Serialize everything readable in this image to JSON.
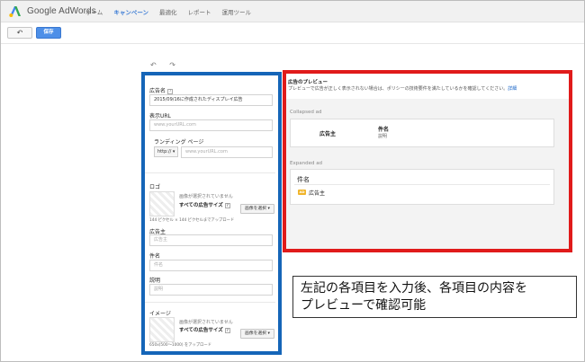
{
  "app": {
    "name": "Google AdWords"
  },
  "nav": [
    {
      "label": "ホーム",
      "active": false
    },
    {
      "label": "キャンペーン",
      "active": true
    },
    {
      "label": "最適化",
      "active": false
    },
    {
      "label": "レポート",
      "active": false
    },
    {
      "label": "運用ツール",
      "active": false
    }
  ],
  "toolbar": {
    "back_icon": "↶",
    "save_label": "保存"
  },
  "editor": {
    "undo_redo": "↶ ↷"
  },
  "form": {
    "ad_name_label": "広告名",
    "ad_name_value": "2015/09/16に作成されたディスプレイ広告",
    "display_url_label": "表示URL",
    "display_url_placeholder": "www.yourURL.com",
    "landing_page_label": "ランディング ページ",
    "protocol_value": "http://",
    "landing_url_placeholder": "www.yourURL.com",
    "logo_label": "ロゴ",
    "logo_no_image": "画像が選択されていません",
    "logo_size_label": "すべての広告サイズ",
    "logo_select_button": "画像を選択",
    "logo_note": "144 ピクセル × 144 ピクセルまでアップロード",
    "advertiser_label": "広告主",
    "advertiser_placeholder": "広告主",
    "headline_label": "件名",
    "headline_placeholder": "件名",
    "description_label": "説明",
    "description_placeholder": "説明",
    "image_label": "イメージ",
    "image_no_image": "画像が選択されていません",
    "image_size_label": "すべての広告サイズ",
    "image_select_button": "画像を選択",
    "image_note": "650x(500～1000) をアップロード"
  },
  "preview": {
    "title": "広告のプレビュー",
    "description": "プレビューで広告が正しく表示されない場合は、ポリシーの技術要件を満たしているかを確認してください。",
    "details_link": "詳細",
    "collapsed_label": "Collapsed ad",
    "collapsed_advertiser": "広告主",
    "collapsed_headline": "件名",
    "collapsed_description": "説明",
    "expanded_label": "Expanded ad",
    "expanded_headline": "件名",
    "expanded_badge": "AD",
    "expanded_advertiser": "広告主"
  },
  "callout": {
    "line1": "左記の各項目を入力後、各項目の内容を",
    "line2": "プレビューで確認可能"
  },
  "colors": {
    "highlight_blue": "#1565b8",
    "highlight_red": "#e01b1b",
    "accent": "#3a7bd5"
  }
}
